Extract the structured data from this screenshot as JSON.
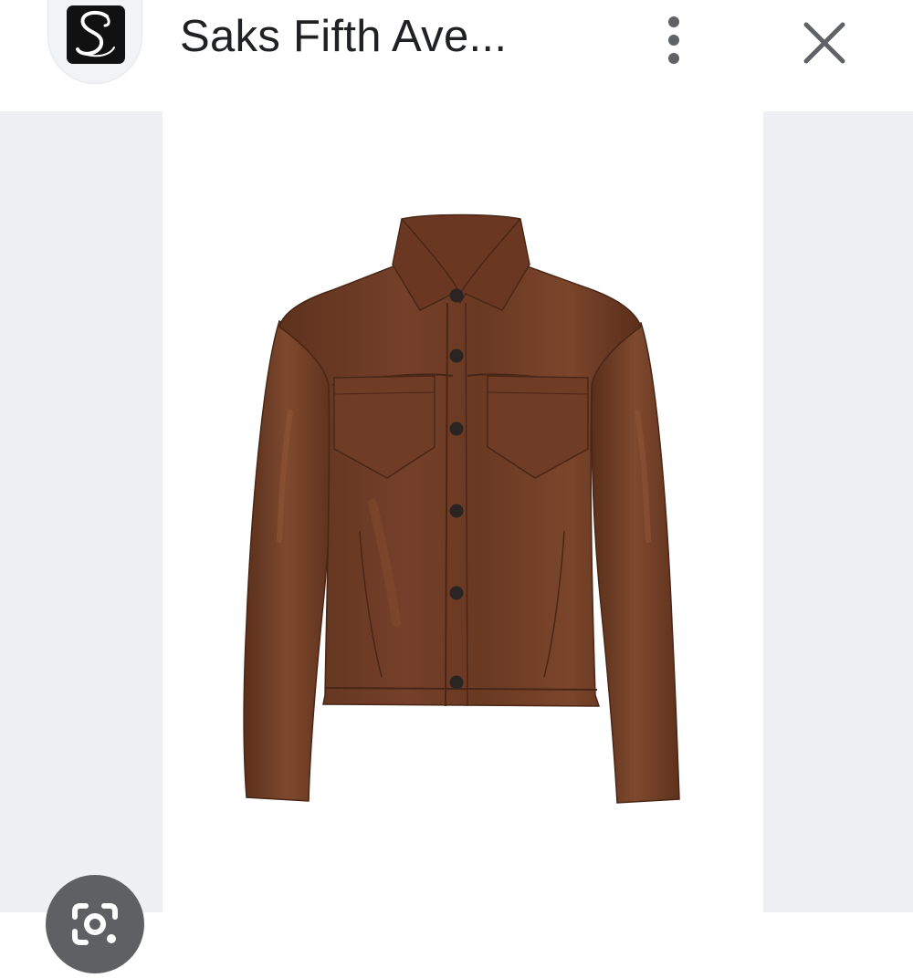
{
  "header": {
    "site_title": "Saks Fifth Ave...",
    "logo_icon": "saks-script-s-logo",
    "more_icon": "more-vertical-icon",
    "close_icon": "close-icon"
  },
  "image_viewer": {
    "subject": "brown leather button-front jacket",
    "colors": {
      "leather": "#6b3a22",
      "leather_shadow": "#4a2616",
      "leather_highlight": "#8a4d2e",
      "buttons": "#2a2523",
      "side_panels": "#eff0f3"
    }
  },
  "lens": {
    "icon": "google-lens-icon",
    "color": "#5f6063"
  }
}
